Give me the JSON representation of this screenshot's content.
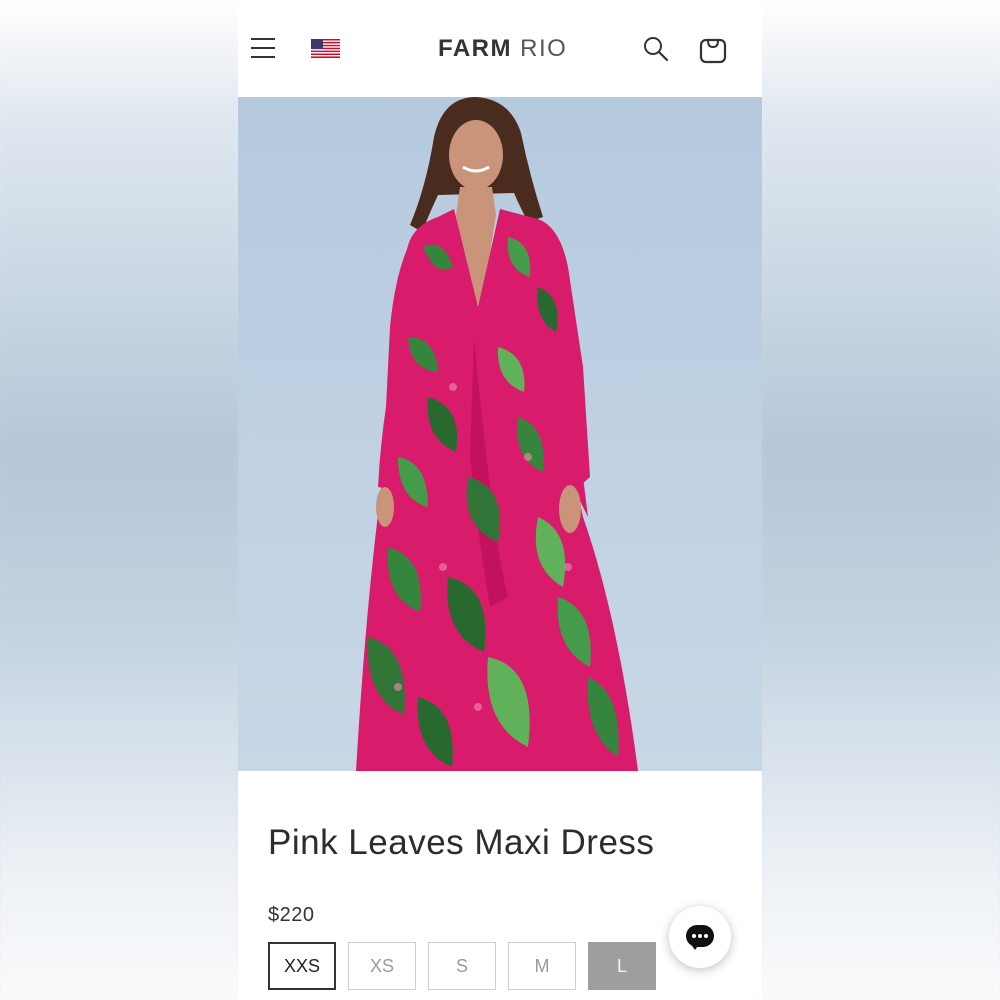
{
  "header": {
    "logo_bold": "FARM",
    "logo_light": "RIO",
    "icons": [
      "menu-icon",
      "us-flag-icon",
      "search-icon",
      "shopping-bag-icon"
    ]
  },
  "product": {
    "title": "Pink Leaves Maxi Dress",
    "price": "$220",
    "image": "model-in-pink-leaf-print-maxi-dress",
    "sizes": [
      {
        "label": "XXS",
        "state": "selected"
      },
      {
        "label": "XS",
        "state": "available"
      },
      {
        "label": "S",
        "state": "available"
      },
      {
        "label": "M",
        "state": "available"
      },
      {
        "label": "L",
        "state": "unavailable"
      }
    ]
  },
  "colors": {
    "text": "#2c2c2c",
    "dress_pink": "#d81b6a",
    "leaf_green": "#2e8b3a",
    "background_blue": "#bdd0e2",
    "size_unavailable": "#9e9e9e"
  },
  "chat": {
    "icon": "chat-bubble-icon"
  }
}
